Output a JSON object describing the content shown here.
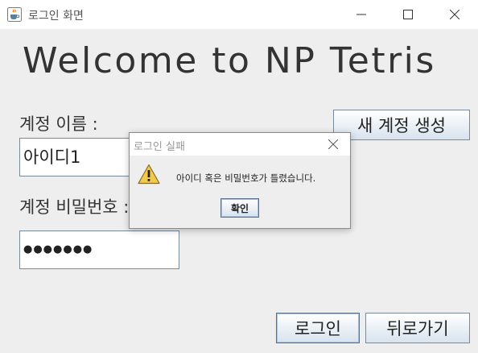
{
  "window": {
    "title": "로그인 화면",
    "app_icon": "java-cup-icon",
    "controls": [
      "minimize-icon",
      "maximize-icon",
      "close-icon"
    ]
  },
  "main": {
    "headline": "Welcome to NP Tetris",
    "account_name_label": "계정 이름 :",
    "account_name_value": "아이디1",
    "password_label": "계정 비밀번호 :",
    "password_masked": "●●●●●●●",
    "create_account_label": "새 계정 생성",
    "login_label": "로그인",
    "back_label": "뒤로가기"
  },
  "dialog": {
    "title": "로그인 실패",
    "icon": "warning-icon",
    "message": "아이디 혹은 비밀번호가 틀렸습니다.",
    "ok_label": "확인"
  },
  "colors": {
    "background": "#eeeeee",
    "button_gradient_top": "#ffffff",
    "button_gradient_bottom": "#d8e3ee",
    "warning_yellow": "#f2c94c"
  }
}
